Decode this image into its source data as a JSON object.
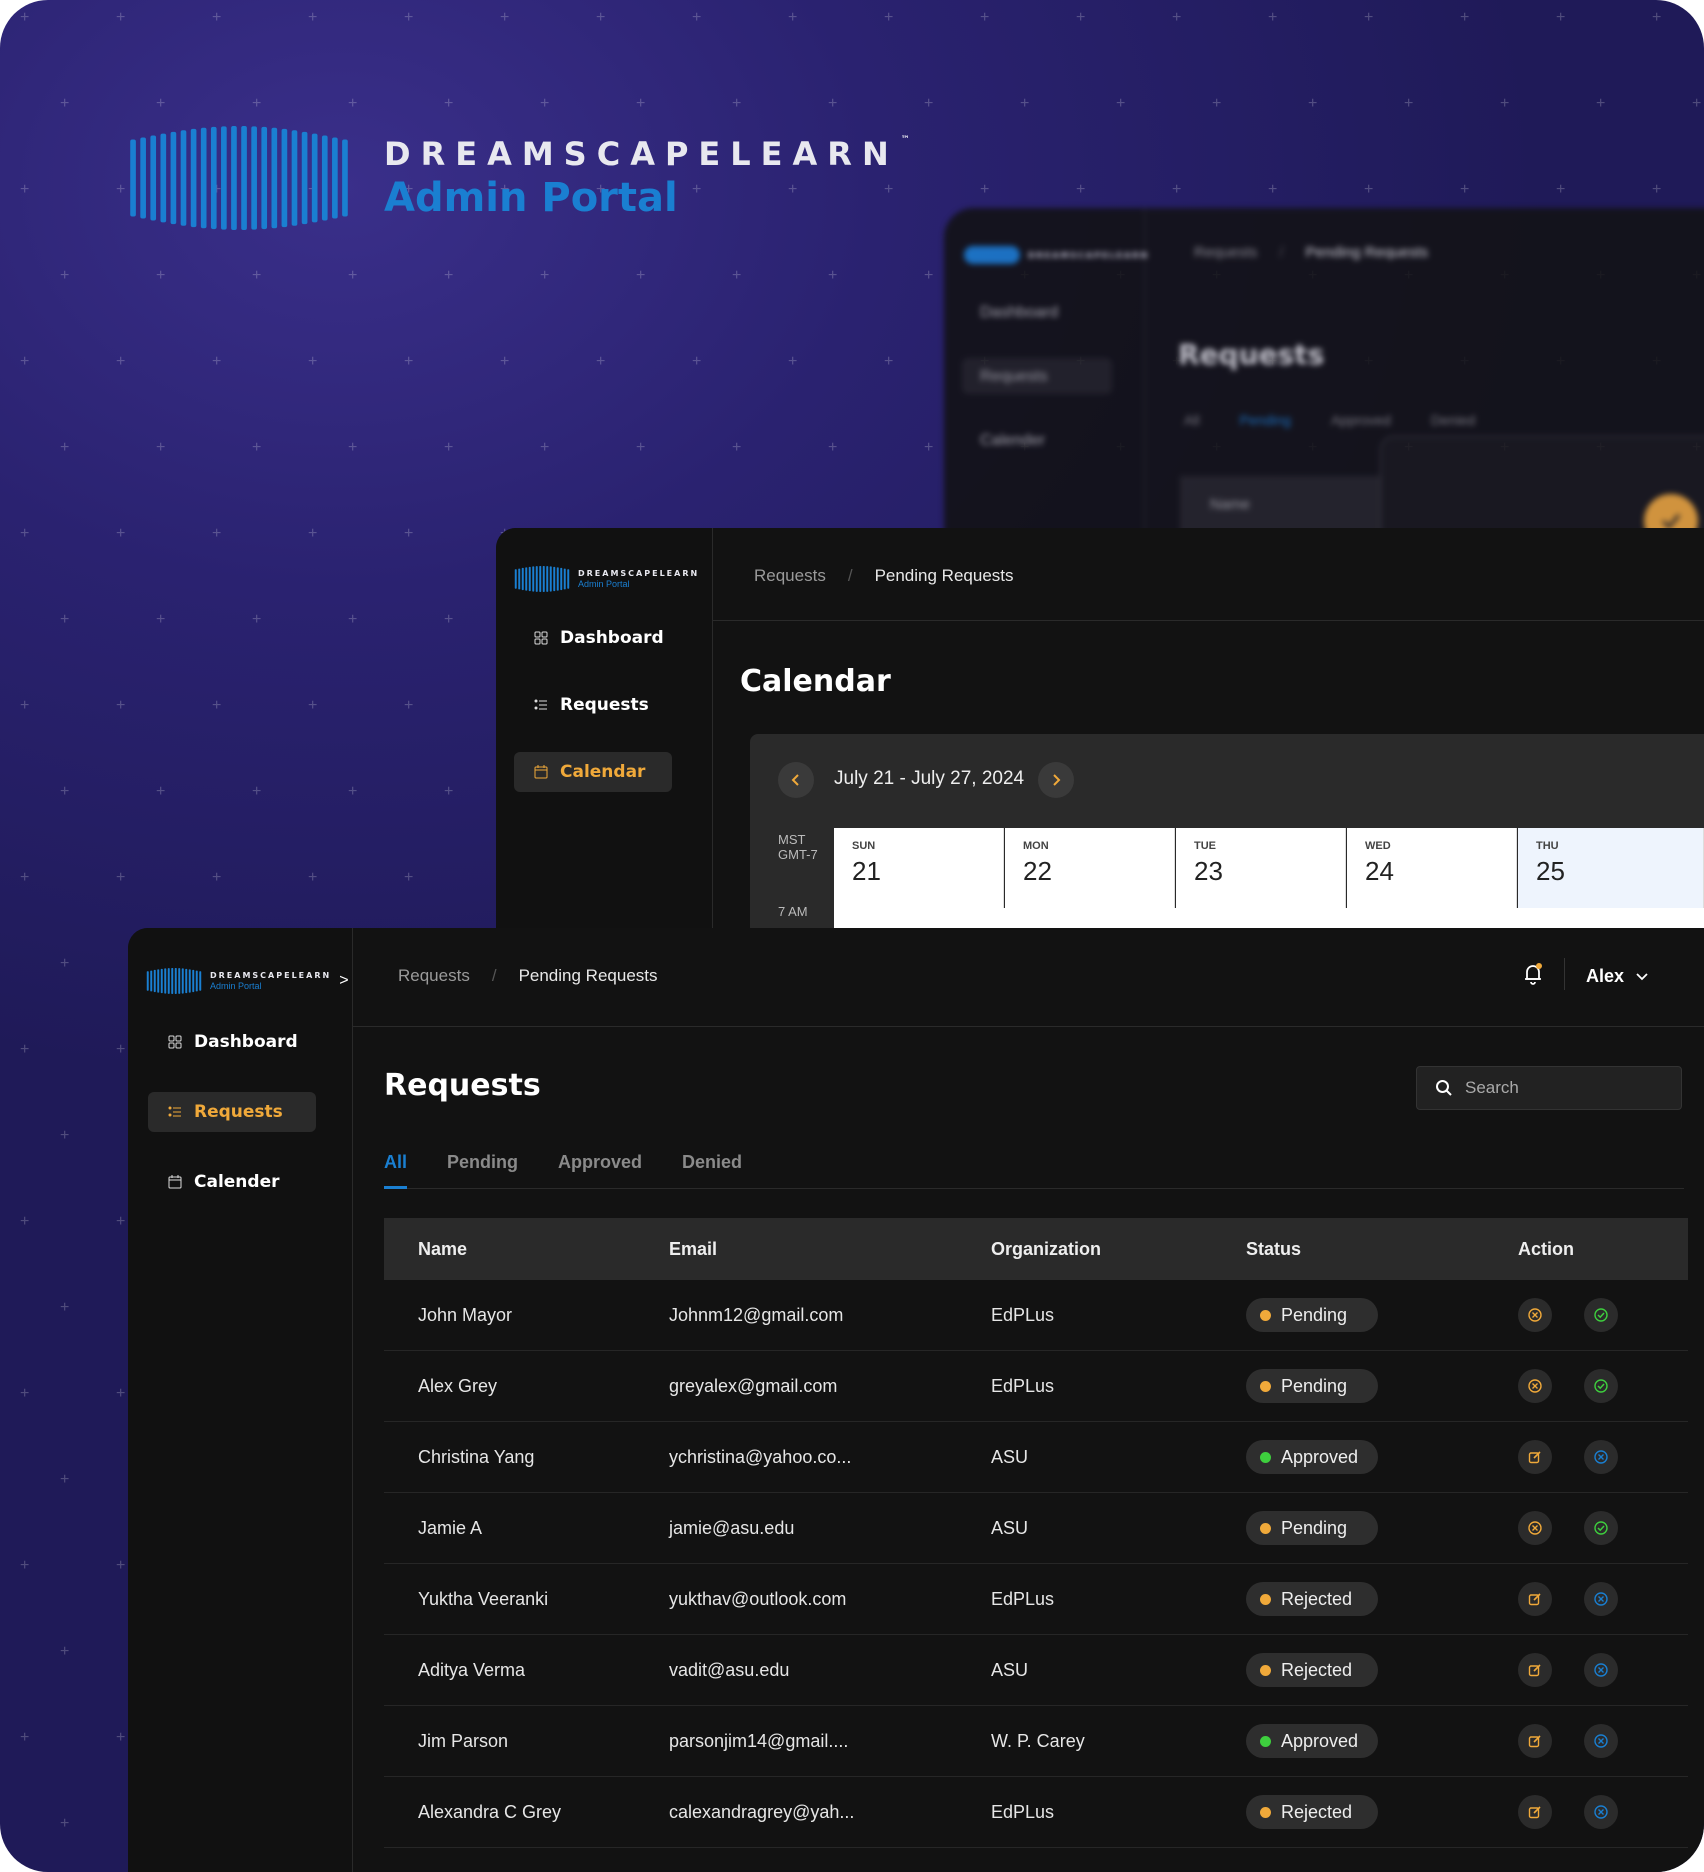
{
  "brand": {
    "wordmark": "DREAMSCAPELEARN",
    "tm": "™",
    "subtitle": "Admin Portal",
    "accent": "#1a7fd1"
  },
  "back_window": {
    "breadcrumbs": [
      "Requests",
      "Pending Requests"
    ],
    "nav": [
      "Dashboard",
      "Requests",
      "Calender"
    ],
    "title": "Requests",
    "tabs": [
      "All",
      "Pending",
      "Approved",
      "Denied"
    ],
    "column": "Name"
  },
  "calendar_window": {
    "breadcrumbs": [
      "Requests",
      "Pending Requests"
    ],
    "nav": [
      {
        "label": "Dashboard",
        "icon": "grid-icon",
        "active": false
      },
      {
        "label": "Requests",
        "icon": "list-icon",
        "active": false
      },
      {
        "label": "Calendar",
        "icon": "calendar-icon",
        "active": true
      }
    ],
    "title": "Calendar",
    "range": "July 21 - July 27, 2024",
    "timezone": [
      "MST",
      "GMT-7"
    ],
    "first_hour": "7 AM",
    "days": [
      {
        "name": "SUN",
        "date": "21"
      },
      {
        "name": "MON",
        "date": "22"
      },
      {
        "name": "TUE",
        "date": "23"
      },
      {
        "name": "WED",
        "date": "24"
      },
      {
        "name": "THU",
        "date": "25"
      }
    ]
  },
  "requests_window": {
    "breadcrumbs": [
      "Requests",
      "Pending Requests"
    ],
    "user": "Alex",
    "nav": [
      {
        "label": "Dashboard",
        "icon": "grid-icon",
        "active": false
      },
      {
        "label": "Requests",
        "icon": "list-icon",
        "active": true
      },
      {
        "label": "Calender",
        "icon": "calendar-icon",
        "active": false
      }
    ],
    "title": "Requests",
    "search_placeholder": "Search",
    "tabs": [
      "All",
      "Pending",
      "Approved",
      "Denied"
    ],
    "active_tab": "All",
    "columns": [
      "Name",
      "Email",
      "Organization",
      "Status",
      "Action"
    ],
    "rows": [
      {
        "name": "John Mayor",
        "email": "Johnm12@gmail.com",
        "org": "EdPLus",
        "status": "Pending"
      },
      {
        "name": "Alex Grey",
        "email": "greyalex@gmail.com",
        "org": "EdPLus",
        "status": "Pending"
      },
      {
        "name": "Christina Yang",
        "email": "ychristina@yahoo.co...",
        "org": "ASU",
        "status": "Approved"
      },
      {
        "name": "Jamie A",
        "email": "jamie@asu.edu",
        "org": "ASU",
        "status": "Pending"
      },
      {
        "name": "Yuktha Veeranki",
        "email": "yukthav@outlook.com",
        "org": "EdPLus",
        "status": "Rejected"
      },
      {
        "name": "Aditya Verma",
        "email": "vadit@asu.edu",
        "org": "ASU",
        "status": "Rejected"
      },
      {
        "name": "Jim Parson",
        "email": "parsonjim14@gmail....",
        "org": "W. P. Carey",
        "status": "Approved"
      },
      {
        "name": "Alexandra C Grey",
        "email": "calexandragrey@yah...",
        "org": "EdPLus",
        "status": "Rejected"
      }
    ],
    "status_colors": {
      "Pending": "#f0a93a",
      "Approved": "#3ecf3e",
      "Rejected": "#f0a93a"
    }
  }
}
